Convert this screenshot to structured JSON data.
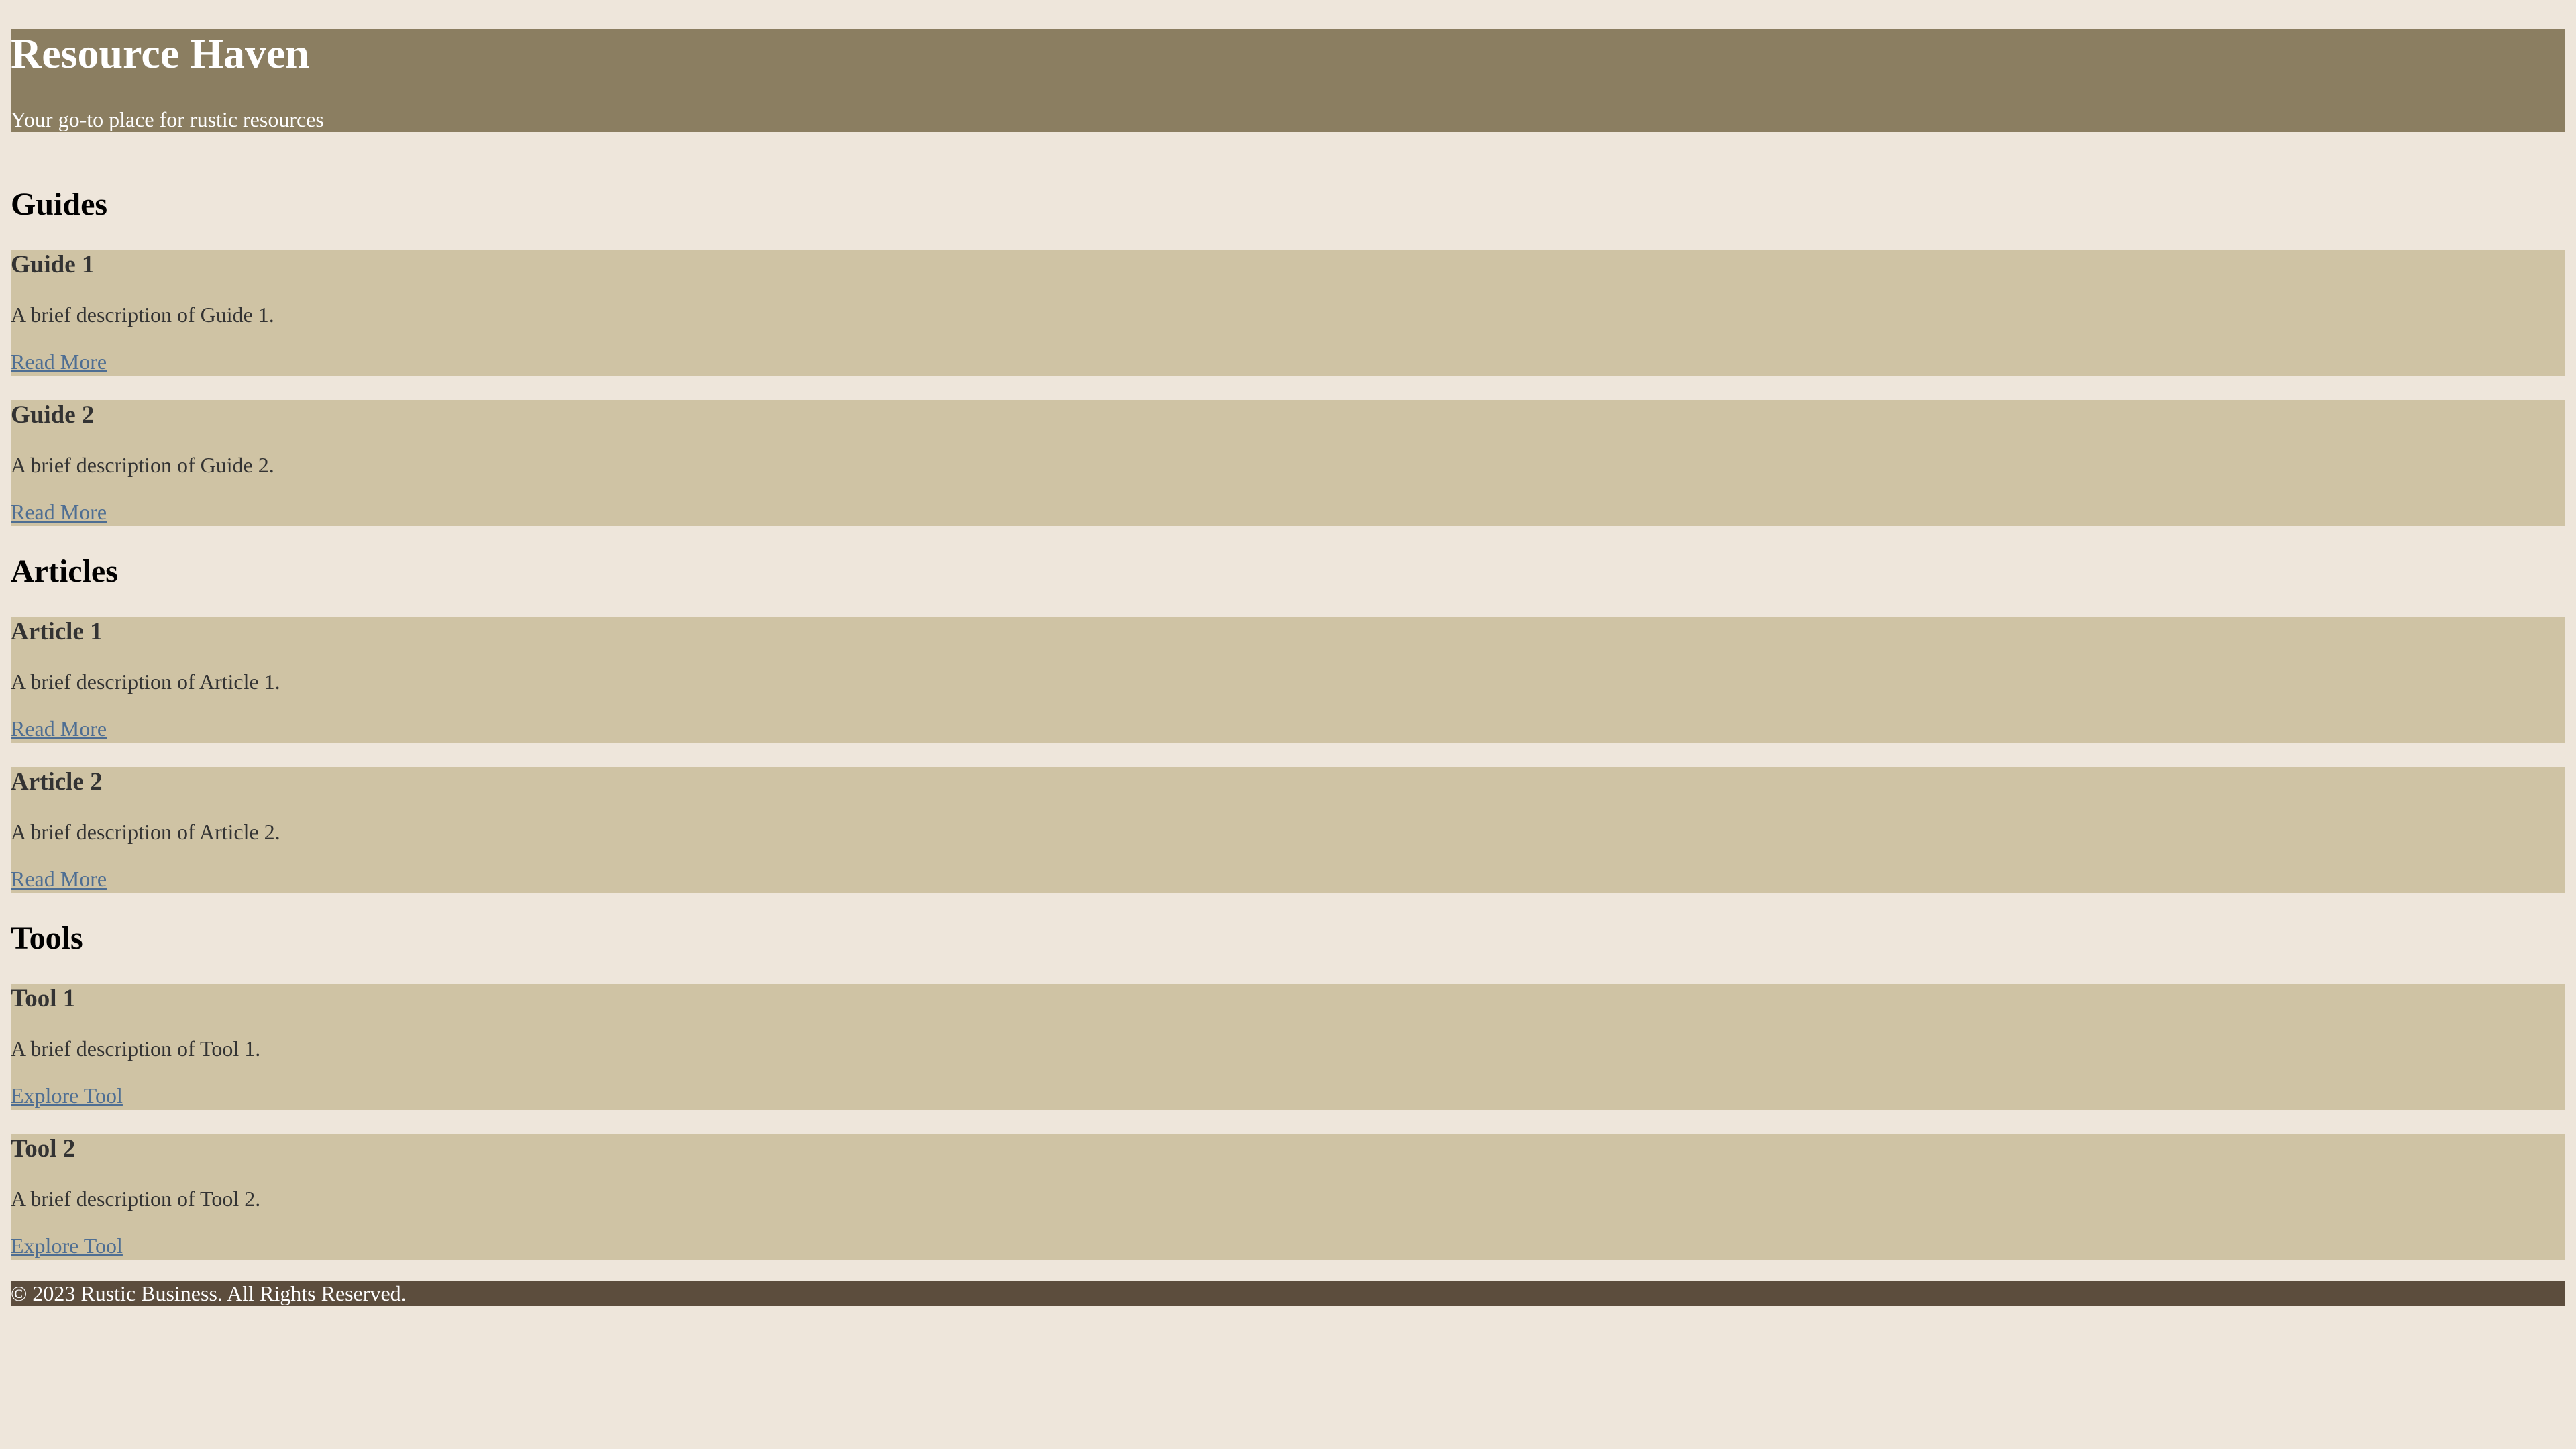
{
  "header": {
    "title": "Resource Haven",
    "tagline": "Your go-to place for rustic resources"
  },
  "sections": [
    {
      "title": "Guides",
      "items": [
        {
          "title": "Guide 1",
          "description": "A brief description of Guide 1.",
          "link": "Read More"
        },
        {
          "title": "Guide 2",
          "description": "A brief description of Guide 2.",
          "link": "Read More"
        }
      ]
    },
    {
      "title": "Articles",
      "items": [
        {
          "title": "Article 1",
          "description": "A brief description of Article 1.",
          "link": "Read More"
        },
        {
          "title": "Article 2",
          "description": "A brief description of Article 2.",
          "link": "Read More"
        }
      ]
    },
    {
      "title": "Tools",
      "items": [
        {
          "title": "Tool 1",
          "description": "A brief description of Tool 1.",
          "link": "Explore Tool"
        },
        {
          "title": "Tool 2",
          "description": "A brief description of Tool 2.",
          "link": "Explore Tool"
        }
      ]
    }
  ],
  "footer": {
    "text": "© 2023 Rustic Business. All Rights Reserved."
  },
  "colors": {
    "page_background": "#EEE6DB",
    "header_background": "#8B7E61",
    "card_background": "#CFC3A4",
    "footer_background": "#5C4D3D",
    "link": "#4E6E93"
  }
}
